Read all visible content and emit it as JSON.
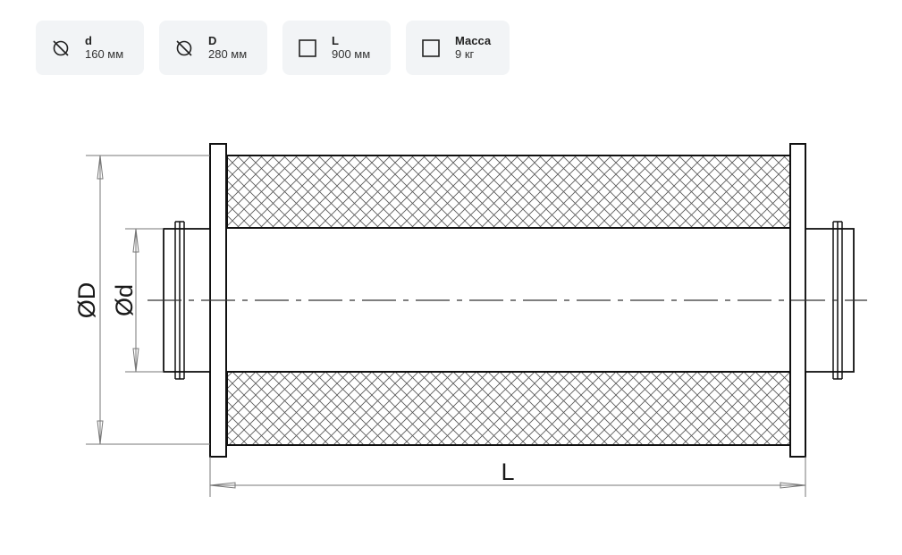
{
  "specs": [
    {
      "icon": "diameter-icon",
      "label": "d",
      "value": "160 мм"
    },
    {
      "icon": "diameter-icon",
      "label": "D",
      "value": "280 мм"
    },
    {
      "icon": "square-icon",
      "label": "L",
      "value": "900 мм"
    },
    {
      "icon": "square-icon",
      "label": "Масса",
      "value": "9 кг"
    }
  ],
  "drawing": {
    "label_outer_diameter": "ØD",
    "label_inner_diameter": "Ød",
    "label_length": "L"
  }
}
